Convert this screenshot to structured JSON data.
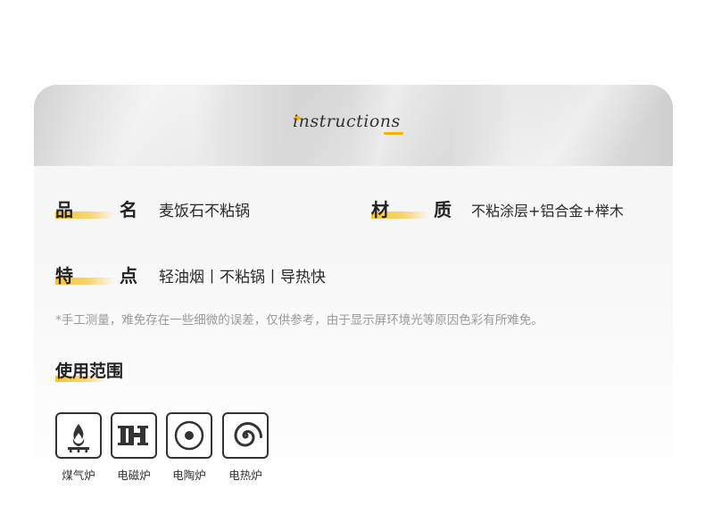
{
  "banner": {
    "title": "instructions"
  },
  "specs": {
    "name": {
      "label_1": "品",
      "label_2": "名",
      "value": "麦饭石不粘锅"
    },
    "material": {
      "label_1": "材",
      "label_2": "质",
      "value": "不粘涂层+铝合金+榉木"
    },
    "feature": {
      "label_1": "特",
      "label_2": "点",
      "value": "轻油烟丨不粘锅丨导热快"
    }
  },
  "note": "*手工测量，难免存在一些细微的误差，仅供参考，由于显示屏环境光等原因色彩有所难免。",
  "usage": {
    "title": "使用范围",
    "stoves": [
      {
        "label": "煤气炉",
        "icon": "gas-stove-icon"
      },
      {
        "label": "电磁炉",
        "icon": "induction-icon"
      },
      {
        "label": "电陶炉",
        "icon": "ceramic-stove-icon"
      },
      {
        "label": "电热炉",
        "icon": "electric-coil-icon"
      }
    ]
  },
  "colors": {
    "accent": "#f5b400",
    "text": "#222222",
    "note": "#9a9a9a"
  }
}
